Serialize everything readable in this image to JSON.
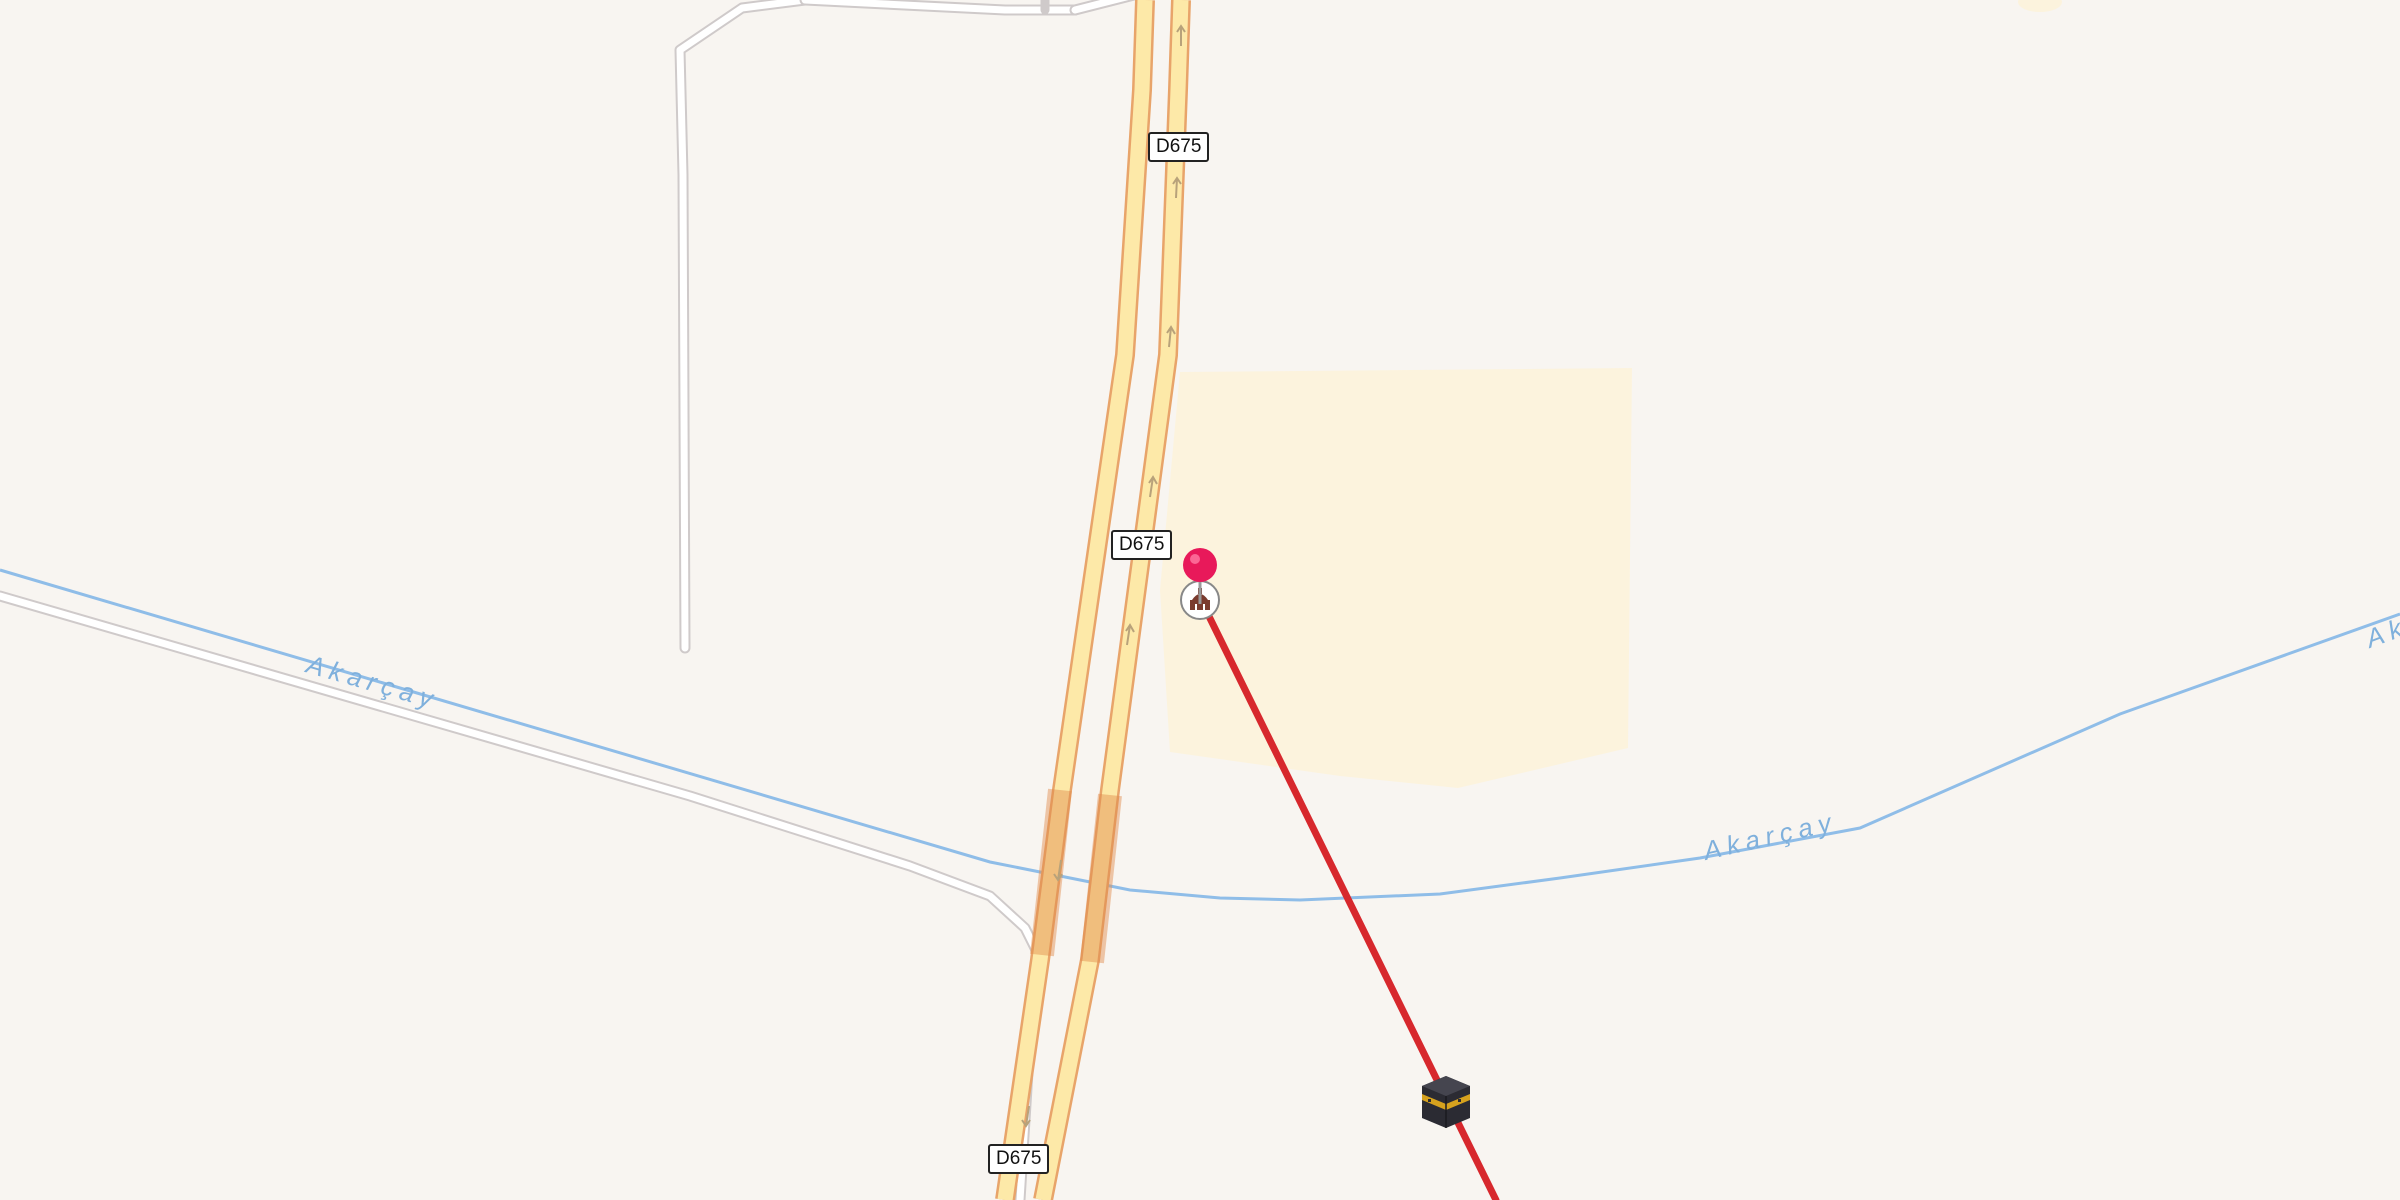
{
  "map": {
    "road_label": "D675",
    "river_label_1": "Akarçay",
    "river_label_2": "Akarçay",
    "river_label_3": "Ak",
    "colors": {
      "background": "#f8f5f1",
      "road_fill": "#fde9a8",
      "road_casing": "#e8a46a",
      "river": "#8fbde8",
      "minor_road": "#d0cccc",
      "area": "#fcf3dd",
      "qibla_line": "#d7282d",
      "pin": "#e8195a"
    },
    "icons": [
      "map-pin-icon",
      "mosque-icon",
      "kaaba-icon",
      "one-way-arrow-icon"
    ]
  }
}
